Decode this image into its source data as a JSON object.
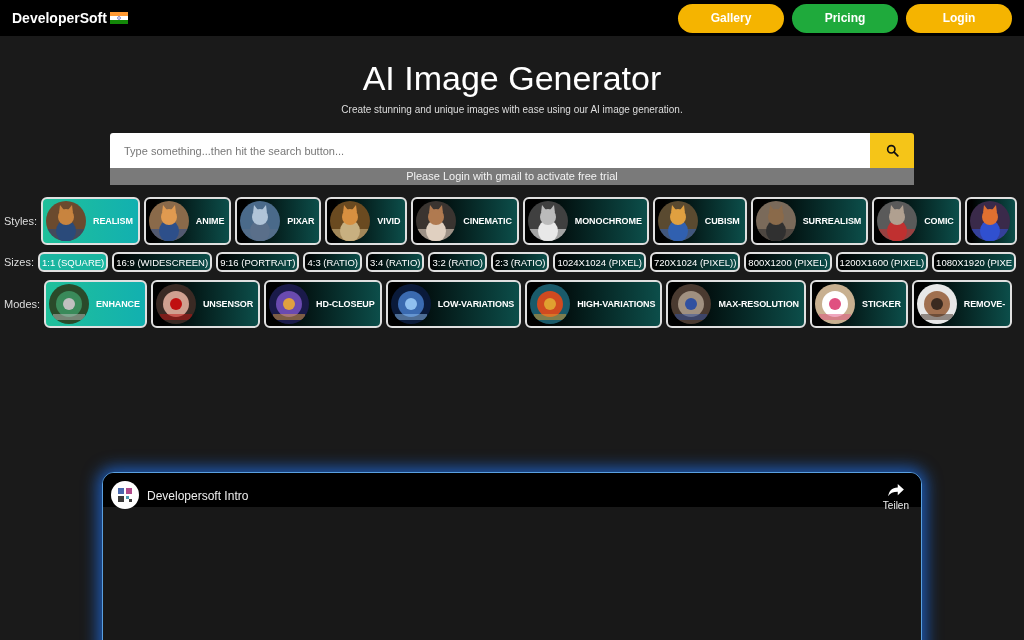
{
  "header": {
    "brand": "DeveloperSoft",
    "nav": [
      {
        "label": "Gallery",
        "color": "#f5b400"
      },
      {
        "label": "Pricing",
        "color": "#1faa3c"
      },
      {
        "label": "Login",
        "color": "#f5b400"
      }
    ]
  },
  "hero": {
    "title": "AI Image Generator",
    "subtitle": "Create stunning and unique images with ease using our AI image generation.",
    "search": {
      "placeholder": "Type something...then hit the search button..."
    },
    "notice": "Please Login with gmail to activate free trial"
  },
  "styles": {
    "label": "Styles:",
    "items": [
      {
        "label": "REALISM",
        "selected": true
      },
      {
        "label": "ANIME",
        "selected": false
      },
      {
        "label": "PIXAR",
        "selected": false
      },
      {
        "label": "VIVID",
        "selected": false
      },
      {
        "label": "CINEMATIC",
        "selected": false
      },
      {
        "label": "MONOCHROME",
        "selected": false
      },
      {
        "label": "CUBISM",
        "selected": false
      },
      {
        "label": "SURREALISM",
        "selected": false
      },
      {
        "label": "COMIC",
        "selected": false
      },
      {
        "selected": false
      }
    ]
  },
  "sizes": {
    "label": "Sizes:",
    "items": [
      {
        "label": "1:1 (SQUARE)",
        "selected": true
      },
      {
        "label": "16:9 (WIDESCREEN)",
        "selected": false
      },
      {
        "label": "9:16 (PORTRAIT)",
        "selected": false
      },
      {
        "label": "4:3 (RATIO)",
        "selected": false
      },
      {
        "label": "3:4 (RATIO)",
        "selected": false
      },
      {
        "label": "3:2 (RATIO)",
        "selected": false
      },
      {
        "label": "2:3 (RATIO)",
        "selected": false
      },
      {
        "label": "1024X1024 (PIXEL)",
        "selected": false
      },
      {
        "label": "720X1024 (PIXEL))",
        "selected": false
      },
      {
        "label": "800X1200 (PIXEL)",
        "selected": false
      },
      {
        "label": "1200X1600 (PIXEL)",
        "selected": false
      },
      {
        "label": "1080X1920 (PIXE",
        "selected": false
      }
    ]
  },
  "modes": {
    "label": "Modes:",
    "items": [
      {
        "label": "ENHANCE",
        "selected": true
      },
      {
        "label": "UNSENSOR",
        "selected": false
      },
      {
        "label": "HD-CLOSEUP",
        "selected": false
      },
      {
        "label": "LOW-VARIATIONS",
        "selected": false
      },
      {
        "label": "HIGH-VARIATIONS",
        "selected": false
      },
      {
        "label": "MAX-RESOLUTION",
        "selected": false
      },
      {
        "label": "STICKER",
        "selected": false
      },
      {
        "label": "REMOVE-",
        "selected": false
      }
    ]
  },
  "video": {
    "title": "Developersoft Intro",
    "share_label": "Teilen"
  }
}
